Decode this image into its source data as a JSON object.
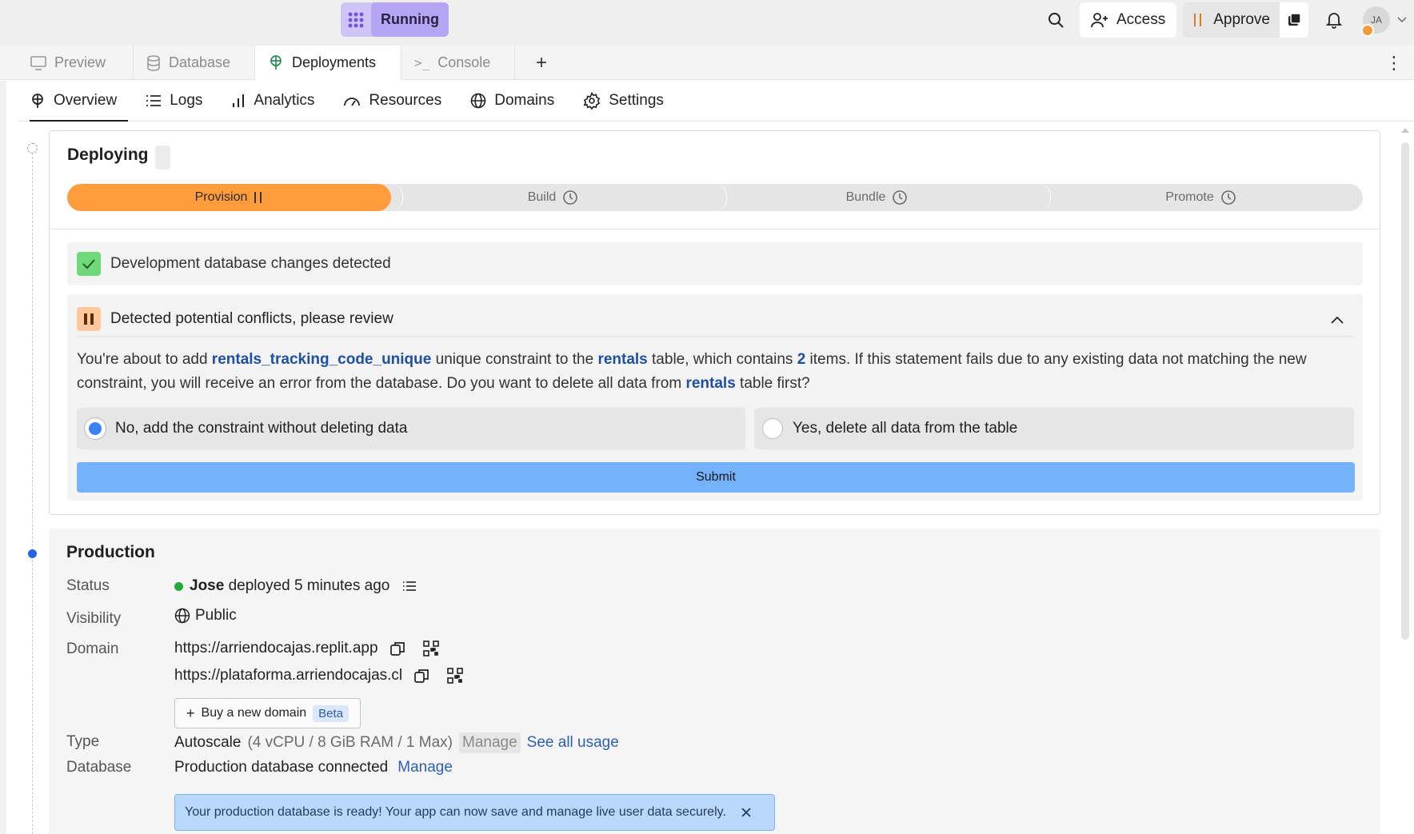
{
  "topbar": {
    "run_label": "Running",
    "access_label": "Access",
    "approve_label": "Approve",
    "avatar_initials": "JA"
  },
  "file_tabs": [
    {
      "label": "Preview",
      "icon": "monitor-icon"
    },
    {
      "label": "Database",
      "icon": "database-icon"
    },
    {
      "label": "Deployments",
      "icon": "deployments-icon"
    },
    {
      "label": "Console",
      "icon": "terminal-icon"
    }
  ],
  "subnav": [
    {
      "label": "Overview",
      "icon": "deployments-icon"
    },
    {
      "label": "Logs",
      "icon": "list-icon"
    },
    {
      "label": "Analytics",
      "icon": "bar-chart-icon"
    },
    {
      "label": "Resources",
      "icon": "gauge-icon"
    },
    {
      "label": "Domains",
      "icon": "globe-icon"
    },
    {
      "label": "Settings",
      "icon": "gear-icon"
    }
  ],
  "deploying": {
    "title": "Deploying",
    "steps": [
      {
        "label": "Provision",
        "state": "active"
      },
      {
        "label": "Build",
        "state": "pending"
      },
      {
        "label": "Bundle",
        "state": "pending"
      },
      {
        "label": "Promote",
        "state": "pending"
      }
    ],
    "db_changes": "Development database changes detected",
    "conflict_title": "Detected potential conflicts, please review",
    "conflict": {
      "t1": "You're about to add ",
      "constraint": "rentals_tracking_code_unique",
      "t2": " unique constraint to the ",
      "table": "rentals",
      "t3": " table, which contains ",
      "count": "2",
      "t4": " items. If this statement fails due to any existing data not matching the new constraint, you will receive an error from the database. Do you want to delete all data from ",
      "table2": "rentals",
      "t5": " table first?"
    },
    "option_no": "No, add the constraint without deleting data",
    "option_yes": "Yes, delete all data from the table",
    "submit": "Submit"
  },
  "production": {
    "title": "Production",
    "status_label": "Status",
    "status_user": "Jose",
    "status_text": "deployed 5 minutes ago",
    "visibility_label": "Visibility",
    "visibility_value": "Public",
    "domain_label": "Domain",
    "domain1": "https://arriendocajas.replit.app",
    "domain2": "https://plataforma.arriendocajas.cl",
    "buy_domain": "Buy a new domain",
    "beta": "Beta",
    "type_label": "Type",
    "type_value": "Autoscale",
    "type_spec": "(4 vCPU / 8 GiB RAM / 1 Max)",
    "type_manage": "Manage",
    "see_usage": "See all usage",
    "database_label": "Database",
    "database_value": "Production database connected",
    "database_manage": "Manage",
    "banner": "Your production database is ready! Your app can now save and manage live user data securely."
  },
  "colors": {
    "accent_orange": "#ff9d3c",
    "submit_blue": "#74b2fb",
    "running_purple": "#b6a4f5",
    "link_blue": "#2f5fb0"
  }
}
